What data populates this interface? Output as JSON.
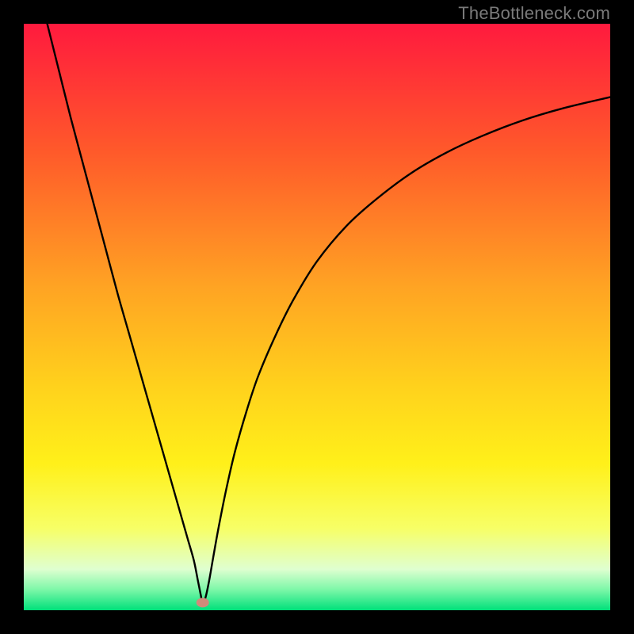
{
  "watermark": "TheBottleneck.com",
  "chart_data": {
    "type": "line",
    "title": "",
    "xlabel": "",
    "ylabel": "",
    "xlim": [
      0,
      100
    ],
    "ylim": [
      0,
      100
    ],
    "gradient_stops": [
      {
        "offset": 0,
        "color": "#ff1a3e"
      },
      {
        "offset": 0.22,
        "color": "#ff5a2a"
      },
      {
        "offset": 0.45,
        "color": "#ffa423"
      },
      {
        "offset": 0.62,
        "color": "#ffd21c"
      },
      {
        "offset": 0.75,
        "color": "#fff01a"
      },
      {
        "offset": 0.86,
        "color": "#f7ff66"
      },
      {
        "offset": 0.93,
        "color": "#dfffd0"
      },
      {
        "offset": 0.965,
        "color": "#7cf7a8"
      },
      {
        "offset": 1.0,
        "color": "#00e07a"
      }
    ],
    "marker": {
      "x": 30.5,
      "y": 1.3,
      "color": "#d08a7a"
    },
    "series": [
      {
        "name": "bottleneck-curve",
        "x": [
          4,
          6,
          8,
          10,
          12,
          14,
          16,
          18,
          20,
          22,
          24,
          26,
          27,
          28,
          29,
          29.7,
          30.2,
          30.5,
          31,
          31.6,
          32.3,
          33.2,
          34.5,
          36,
          38,
          40,
          43,
          46,
          50,
          55,
          60,
          66,
          72,
          78,
          85,
          92,
          100
        ],
        "y": [
          100,
          92,
          84,
          76.5,
          69,
          61.5,
          54,
          47,
          40,
          33,
          26,
          19,
          15.5,
          12,
          8.5,
          5,
          2.5,
          1.0,
          2.2,
          5,
          9,
          14,
          20.5,
          27,
          34,
          40,
          47,
          53,
          59.5,
          65.5,
          70,
          74.5,
          78,
          80.8,
          83.5,
          85.6,
          87.5
        ]
      }
    ]
  }
}
